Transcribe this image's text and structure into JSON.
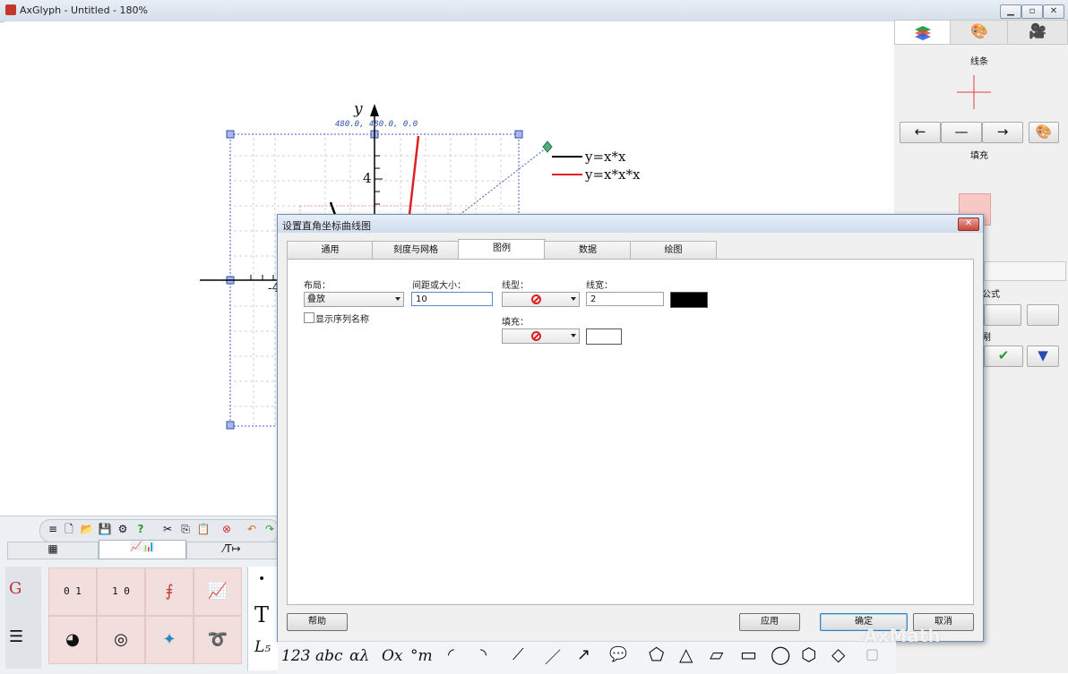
{
  "window": {
    "title": "AxGlyph - Untitled - 180%"
  },
  "plot": {
    "coord_readout": "480.0, 480.0, 0.0",
    "y_axis_label": "y",
    "tick_4": "4",
    "tick_neg4": "-4",
    "legend": [
      "y=x*x",
      "y=x*x*x"
    ],
    "legend_colors": [
      "#000000",
      "#e02020"
    ]
  },
  "right_panel": {
    "tabs": [
      "layers-icon",
      "palette-icon",
      "camera-icon"
    ],
    "line_label": "线条",
    "fill_label": "填充",
    "formula_label": "公式",
    "partial_label": "剐"
  },
  "dialog": {
    "title": "设置直角坐标曲线图",
    "tabs": [
      "通用",
      "刻度与网格",
      "图例",
      "数据",
      "绘图"
    ],
    "active_tab": "图例",
    "layout_label": "布局：",
    "layout_value": "叠放",
    "spacing_label": "间距或大小：",
    "spacing_value": "10",
    "linetype_label": "线型：",
    "linewidth_label": "线宽：",
    "linewidth_value": "2",
    "fill_label": "填充：",
    "show_series_label": "显示序列名称",
    "line_color": "#000000",
    "fill_color": "#ffffff",
    "buttons": {
      "help": "帮助",
      "apply": "应用",
      "ok": "确定",
      "cancel": "取消"
    }
  },
  "toolbox": {
    "ruler_label": "0 1",
    "colorbar_label": "1 0",
    "text_tools": [
      "T",
      "L₅",
      "123",
      "abc",
      "αλ",
      "Ox",
      "°m"
    ]
  },
  "watermark": "AxMath"
}
